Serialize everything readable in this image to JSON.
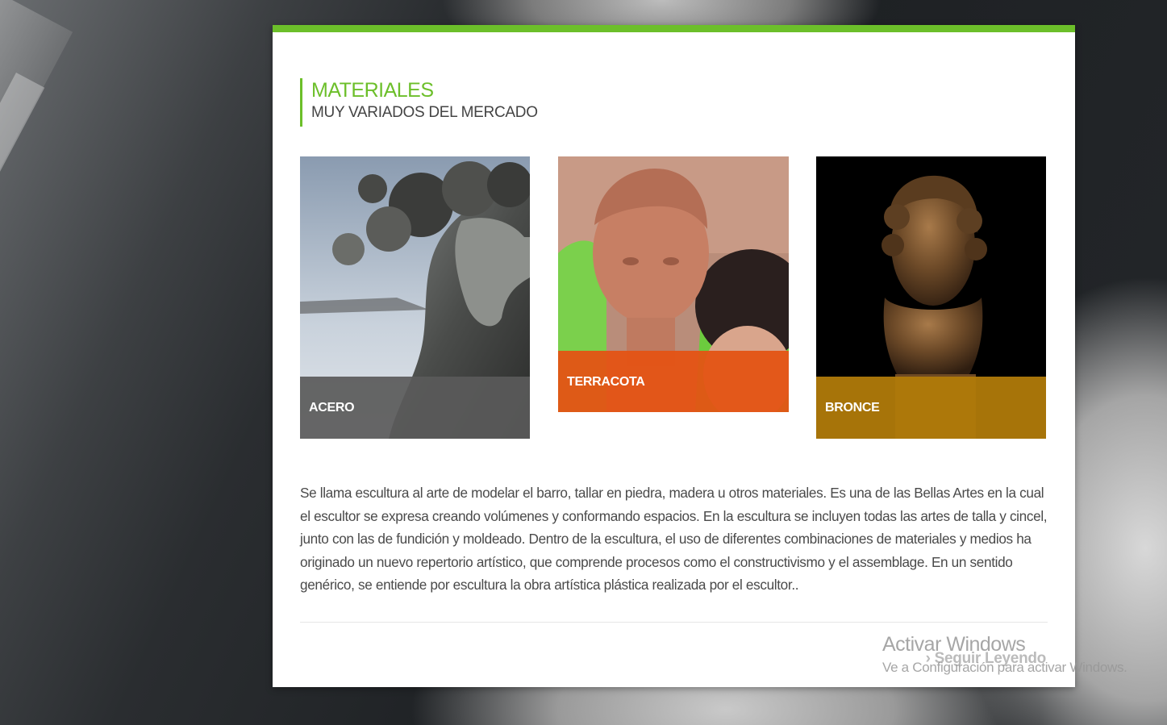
{
  "section": {
    "title": "MATERIALES",
    "subtitle": "MUY VARIADOS DEL MERCADO"
  },
  "materials": [
    {
      "label": "ACERO",
      "color": "#5a5a5a"
    },
    {
      "label": "TERRACOTA",
      "color": "#e45314"
    },
    {
      "label": "BRONCE",
      "color": "#b07a0a"
    }
  ],
  "description": "Se llama escultura al arte de modelar el barro, tallar en piedra, madera u otros materiales. Es una de las Bellas Artes en la cual el escultor se expresa creando volúmenes y conformando espacios. En la escultura se incluyen todas las artes de talla y cincel, junto con las de fundición y moldeado. Dentro de la escultura, el uso de diferentes combinaciones de materiales y medios ha originado un nuevo repertorio artístico, que comprende procesos como el constructivismo y el assemblage. En un sentido genérico, se entiende por escultura la obra artística plástica realizada por el escultor..",
  "read_more": "› Seguir Leyendo",
  "watermark": {
    "line1": "Activar Windows",
    "line2": "Ve a Configuración para activar Windows."
  },
  "colors": {
    "accent": "#6cbf2a",
    "text": "#4a4a4a"
  }
}
